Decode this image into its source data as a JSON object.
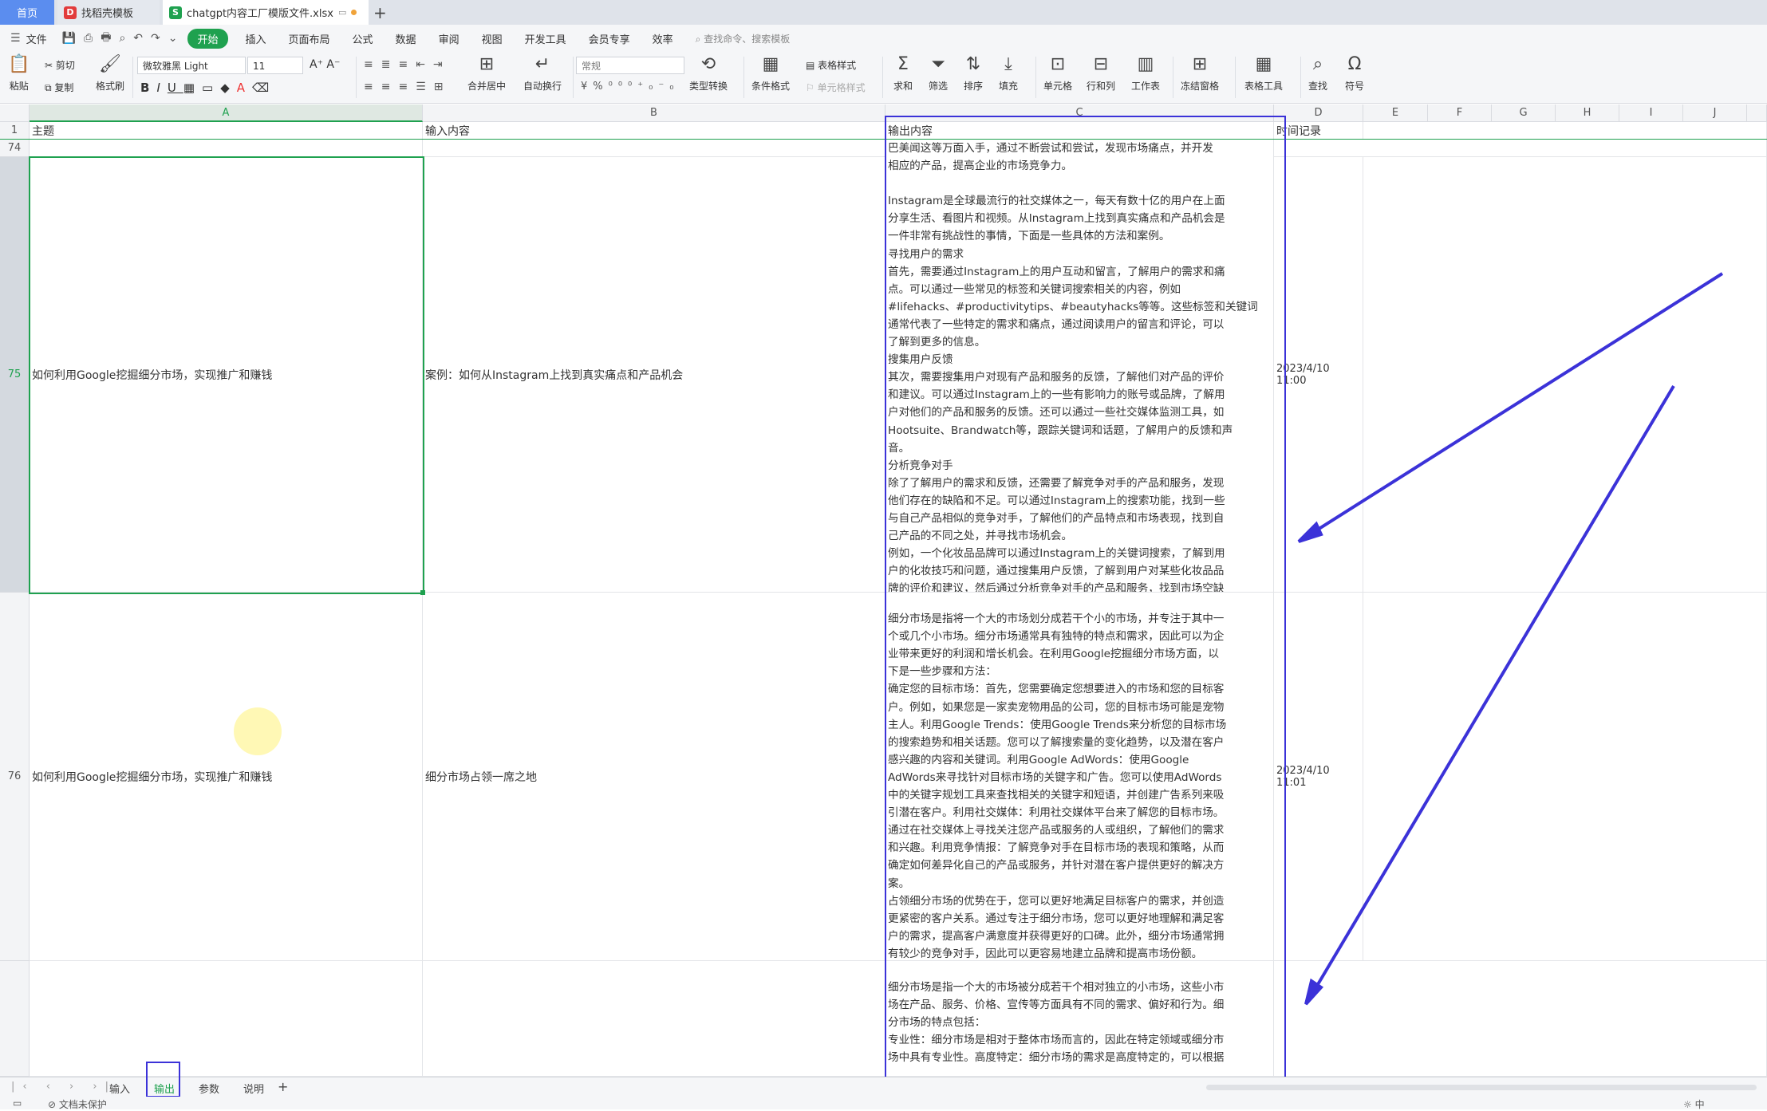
{
  "tabs": {
    "home": "首页",
    "docer": "找稻壳模板",
    "file": "chatgpt内容工厂模版文件.xlsx",
    "add": "+"
  },
  "menu": {
    "file": "文件",
    "items": [
      "开始",
      "插入",
      "页面布局",
      "公式",
      "数据",
      "审阅",
      "视图",
      "开发工具",
      "会员专享",
      "效率"
    ],
    "search": "查找命令、搜索模板"
  },
  "ribbon": {
    "paste": "粘贴",
    "cut": "剪切",
    "copy": "复制",
    "format_painter": "格式刷",
    "font_name": "微软雅黑 Light",
    "font_size": "11",
    "merge": "合并居中",
    "wrap": "自动换行",
    "number_format": "常规",
    "type_convert": "类型转换",
    "cond_format": "条件格式",
    "table_style": "表格样式",
    "cell_style": "单元格样式",
    "sum": "求和",
    "filter": "筛选",
    "sort": "排序",
    "fill": "填充",
    "cell": "单元格",
    "row_col": "行和列",
    "sheet": "工作表",
    "freeze": "冻结窗格",
    "table_tools": "表格工具",
    "find": "查找",
    "symbol": "符号"
  },
  "columns": [
    "A",
    "B",
    "C",
    "D",
    "E",
    "F",
    "G",
    "H",
    "I",
    "J"
  ],
  "header_row": {
    "num": "1",
    "a": "主题",
    "b": "输入内容",
    "c": "输出内容",
    "d": "时间记录"
  },
  "row74": {
    "num": "74"
  },
  "row75": {
    "num": "75",
    "a": "如何利用Google挖掘细分市场，实现推广和赚钱",
    "b": "案例：如何从Instagram上找到真实痛点和产品机会",
    "d": "2023/4/10 11:00",
    "c": "巴美闻这等万面入手，通过不断尝试和尝试，发现市场痛点，并开发\n相应的产品，提高企业的市场竞争力。\n\nInstagram是全球最流行的社交媒体之一，每天有数十亿的用户在上面\n分享生活、看图片和视频。从Instagram上找到真实痛点和产品机会是\n一件非常有挑战性的事情，下面是一些具体的方法和案例。\n寻找用户的需求\n首先，需要通过Instagram上的用户互动和留言，了解用户的需求和痛\n点。可以通过一些常见的标签和关键词搜索相关的内容，例如\n#lifehacks、#productivitytips、#beautyhacks等等。这些标签和关键词\n通常代表了一些特定的需求和痛点，通过阅读用户的留言和评论，可以\n了解到更多的信息。\n搜集用户反馈\n其次，需要搜集用户对现有产品和服务的反馈，了解他们对产品的评价\n和建议。可以通过Instagram上的一些有影响力的账号或品牌，了解用\n户对他们的产品和服务的反馈。还可以通过一些社交媒体监测工具，如\nHootsuite、Brandwatch等，跟踪关键词和话题，了解用户的反馈和声\n音。\n分析竞争对手\n除了了解用户的需求和反馈，还需要了解竞争对手的产品和服务，发现\n他们存在的缺陷和不足。可以通过Instagram上的搜索功能，找到一些\n与自己产品相似的竞争对手，了解他们的产品特点和市场表现，找到自\n己产品的不同之处，并寻找市场机会。\n例如，一个化妆品品牌可以通过Instagram上的关键词搜索，了解到用\n户的化妆技巧和问题，通过搜集用户反馈，了解到用户对某些化妆品品\n牌的评价和建议，然后通过分析竞争对手的产品和服务，找到市场空缺\n和机会。最终，可以开发出一款更适合用户需求和痛点的产品，提高市"
  },
  "row76": {
    "num": "76",
    "a": "如何利用Google挖掘细分市场，实现推广和赚钱",
    "b": "细分市场占领一席之地",
    "d": "2023/4/10 11:01",
    "c": "\n细分市场是指将一个大的市场划分成若干个小的市场，并专注于其中一\n个或几个小市场。细分市场通常具有独特的特点和需求，因此可以为企\n业带来更好的利润和增长机会。在利用Google挖掘细分市场方面，以\n下是一些步骤和方法：\n确定您的目标市场：首先，您需要确定您想要进入的市场和您的目标客\n户。例如，如果您是一家卖宠物用品的公司，您的目标市场可能是宠物\n主人。利用Google Trends：使用Google Trends来分析您的目标市场\n的搜索趋势和相关话题。您可以了解搜索量的变化趋势，以及潜在客户\n感兴趣的内容和关键词。利用Google AdWords：使用Google\nAdWords来寻找针对目标市场的关键字和广告。您可以使用AdWords\n中的关键字规划工具来查找相关的关键字和短语，并创建广告系列来吸\n引潜在客户。利用社交媒体：利用社交媒体平台来了解您的目标市场。\n通过在社交媒体上寻找关注您产品或服务的人或组织，了解他们的需求\n和兴趣。利用竞争情报：了解竞争对手在目标市场的表现和策略，从而\n确定如何差异化自己的产品或服务，并针对潜在客户提供更好的解决方\n案。\n占领细分市场的优势在于，您可以更好地满足目标客户的需求，并创造\n更紧密的客户关系。通过专注于细分市场，您可以更好地理解和满足客\n户的需求，提高客户满意度并获得更好的口碑。此外，细分市场通常拥\n有较少的竞争对手，因此可以更容易地建立品牌和提高市场份额。"
  },
  "row77": {
    "c": "\n细分市场是指一个大的市场被分成若干个相对独立的小市场，这些小市\n场在产品、服务、价格、宣传等方面具有不同的需求、偏好和行为。细\n分市场的特点包括：\n专业性：细分市场是相对于整体市场而言的，因此在特定领域或细分市\n场中具有专业性。高度特定：细分市场的需求是高度特定的，可以根据"
  },
  "sheets": [
    "输入",
    "输出",
    "参数",
    "说明"
  ],
  "status": {
    "protect": "文档未保护",
    "lang": "中"
  },
  "colors": {
    "accent": "#1fa14f",
    "annotation": "#3b32d8",
    "tab_home": "#5b8def"
  }
}
